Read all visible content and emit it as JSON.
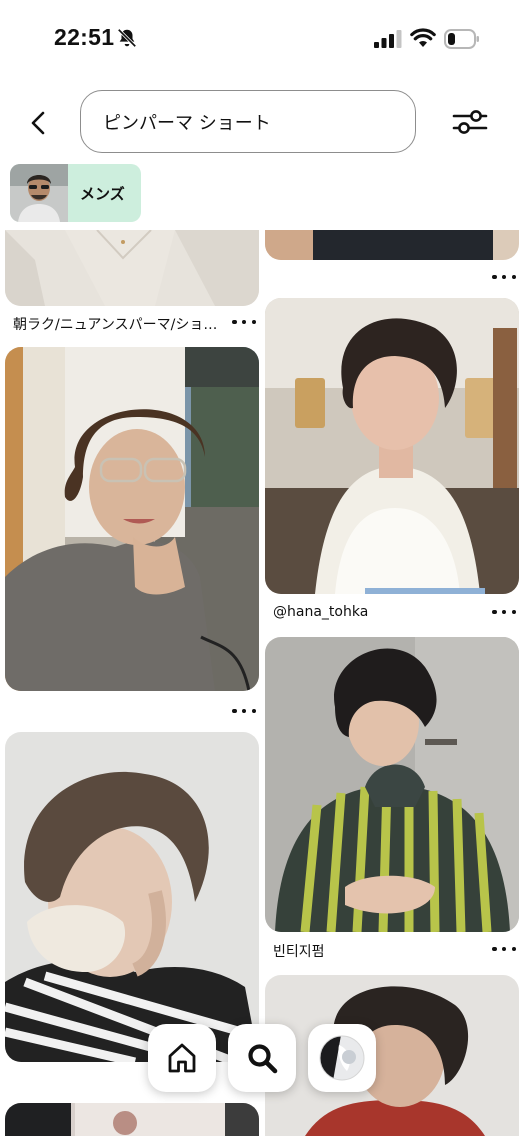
{
  "status_bar": {
    "time": "22:51",
    "icons": [
      "bell-muted-icon",
      "signal-icon",
      "wifi-icon",
      "battery-icon"
    ],
    "battery_level": 0.2
  },
  "header": {
    "back_icon": "chevron-left-icon",
    "search_value": "ピンパーマ ショート",
    "filter_icon": "sliders-icon"
  },
  "chip": {
    "label": "メンズ",
    "background": "#cdeedd"
  },
  "pins": {
    "left": [
      {
        "caption": "朝ラク/ニュアンスパーマ/ショ…",
        "image": "woman-in-beige-top"
      },
      {
        "caption": "",
        "image": "woman-with-glasses-in-grey-sweater"
      },
      {
        "caption": "",
        "image": "person-with-white-mask-striped-top"
      },
      {
        "caption": "",
        "image": "partial-lower-pin"
      }
    ],
    "right": [
      {
        "caption": "",
        "image": "woman-in-dark-top"
      },
      {
        "caption": "@hana_tohka",
        "image": "woman-in-white-tank-top"
      },
      {
        "caption": "빈티지펌",
        "image": "woman-in-striped-sweater"
      },
      {
        "caption": "",
        "image": "man-with-curly-hair-red-top"
      }
    ]
  },
  "bottom_nav": {
    "items": [
      "home-icon",
      "search-icon",
      "profile-avatar"
    ]
  }
}
